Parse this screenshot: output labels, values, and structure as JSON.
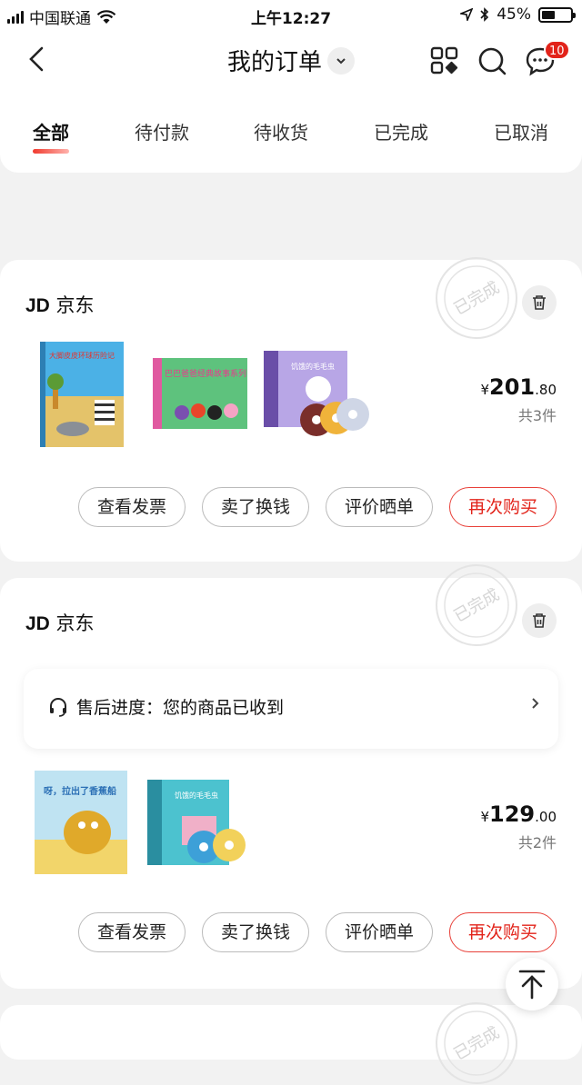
{
  "status_bar": {
    "carrier": "中国联通",
    "time": "上午12:27",
    "battery": "45%",
    "battery_level": 0.45
  },
  "header": {
    "title": "我的订单",
    "message_badge": "10"
  },
  "tabs": [
    {
      "label": "全部"
    },
    {
      "label": "待付款"
    },
    {
      "label": "待收货"
    },
    {
      "label": "已完成"
    },
    {
      "label": "已取消"
    }
  ],
  "actions": {
    "invoice": "查看发票",
    "resell": "卖了换钱",
    "review": "评价晒单",
    "rebuy": "再次购买"
  },
  "stamp_text": "已完成",
  "orders": [
    {
      "shop": "京东",
      "shop_logo": "JD",
      "price_int": "201",
      "price_dec": ".80",
      "price_symbol": "¥",
      "count": "共3件",
      "items": [
        {
          "title": "大脚皮皮环球历险记",
          "color": "#3aa2d8"
        },
        {
          "title": "巴巴爸爸经典故事系列",
          "color": "#3ab16b"
        },
        {
          "title": "饥饿的毛毛虫",
          "color": "#8b6fc7"
        }
      ]
    },
    {
      "shop": "京东",
      "shop_logo": "JD",
      "price_int": "129",
      "price_dec": ".00",
      "price_symbol": "¥",
      "count": "共2件",
      "aftersale": "售后进度：您的商品已收到",
      "items": [
        {
          "title": "呀，拉出了香蕉船",
          "color": "#f2c230"
        },
        {
          "title": "饥饿的毛毛虫",
          "color": "#3cb8c9"
        }
      ]
    }
  ]
}
